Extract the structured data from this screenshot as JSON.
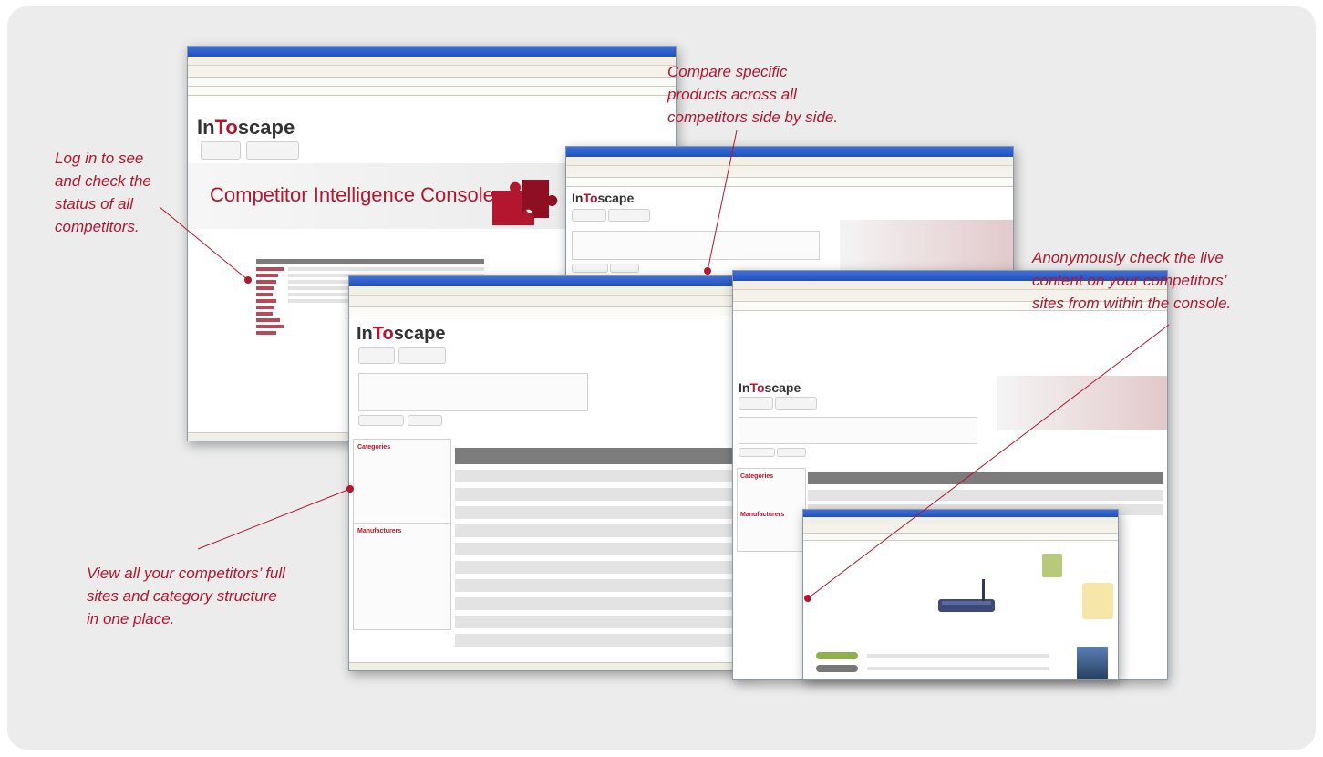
{
  "callouts": {
    "login": [
      "Log in to see",
      "and check the",
      "status of all",
      "competitors."
    ],
    "compare": [
      "Compare specific",
      "products across all",
      "competitors side by side."
    ],
    "anonymous": [
      "Anonymously check the live",
      "content on your competitors’",
      "sites from within the console."
    ],
    "view": [
      "View all your competitors’ full",
      "sites and category structure",
      "in one place."
    ]
  },
  "console": {
    "logo_prefix": "In",
    "logo_highlight": "To",
    "logo_suffix": "scape",
    "title": "Competitor Intelligence Console"
  },
  "sidebar_labels": {
    "categories": "Categories",
    "manufacturers": "Manufacturers"
  },
  "colors": {
    "accent": "#b3162f",
    "panel_bg": "#ececec"
  }
}
